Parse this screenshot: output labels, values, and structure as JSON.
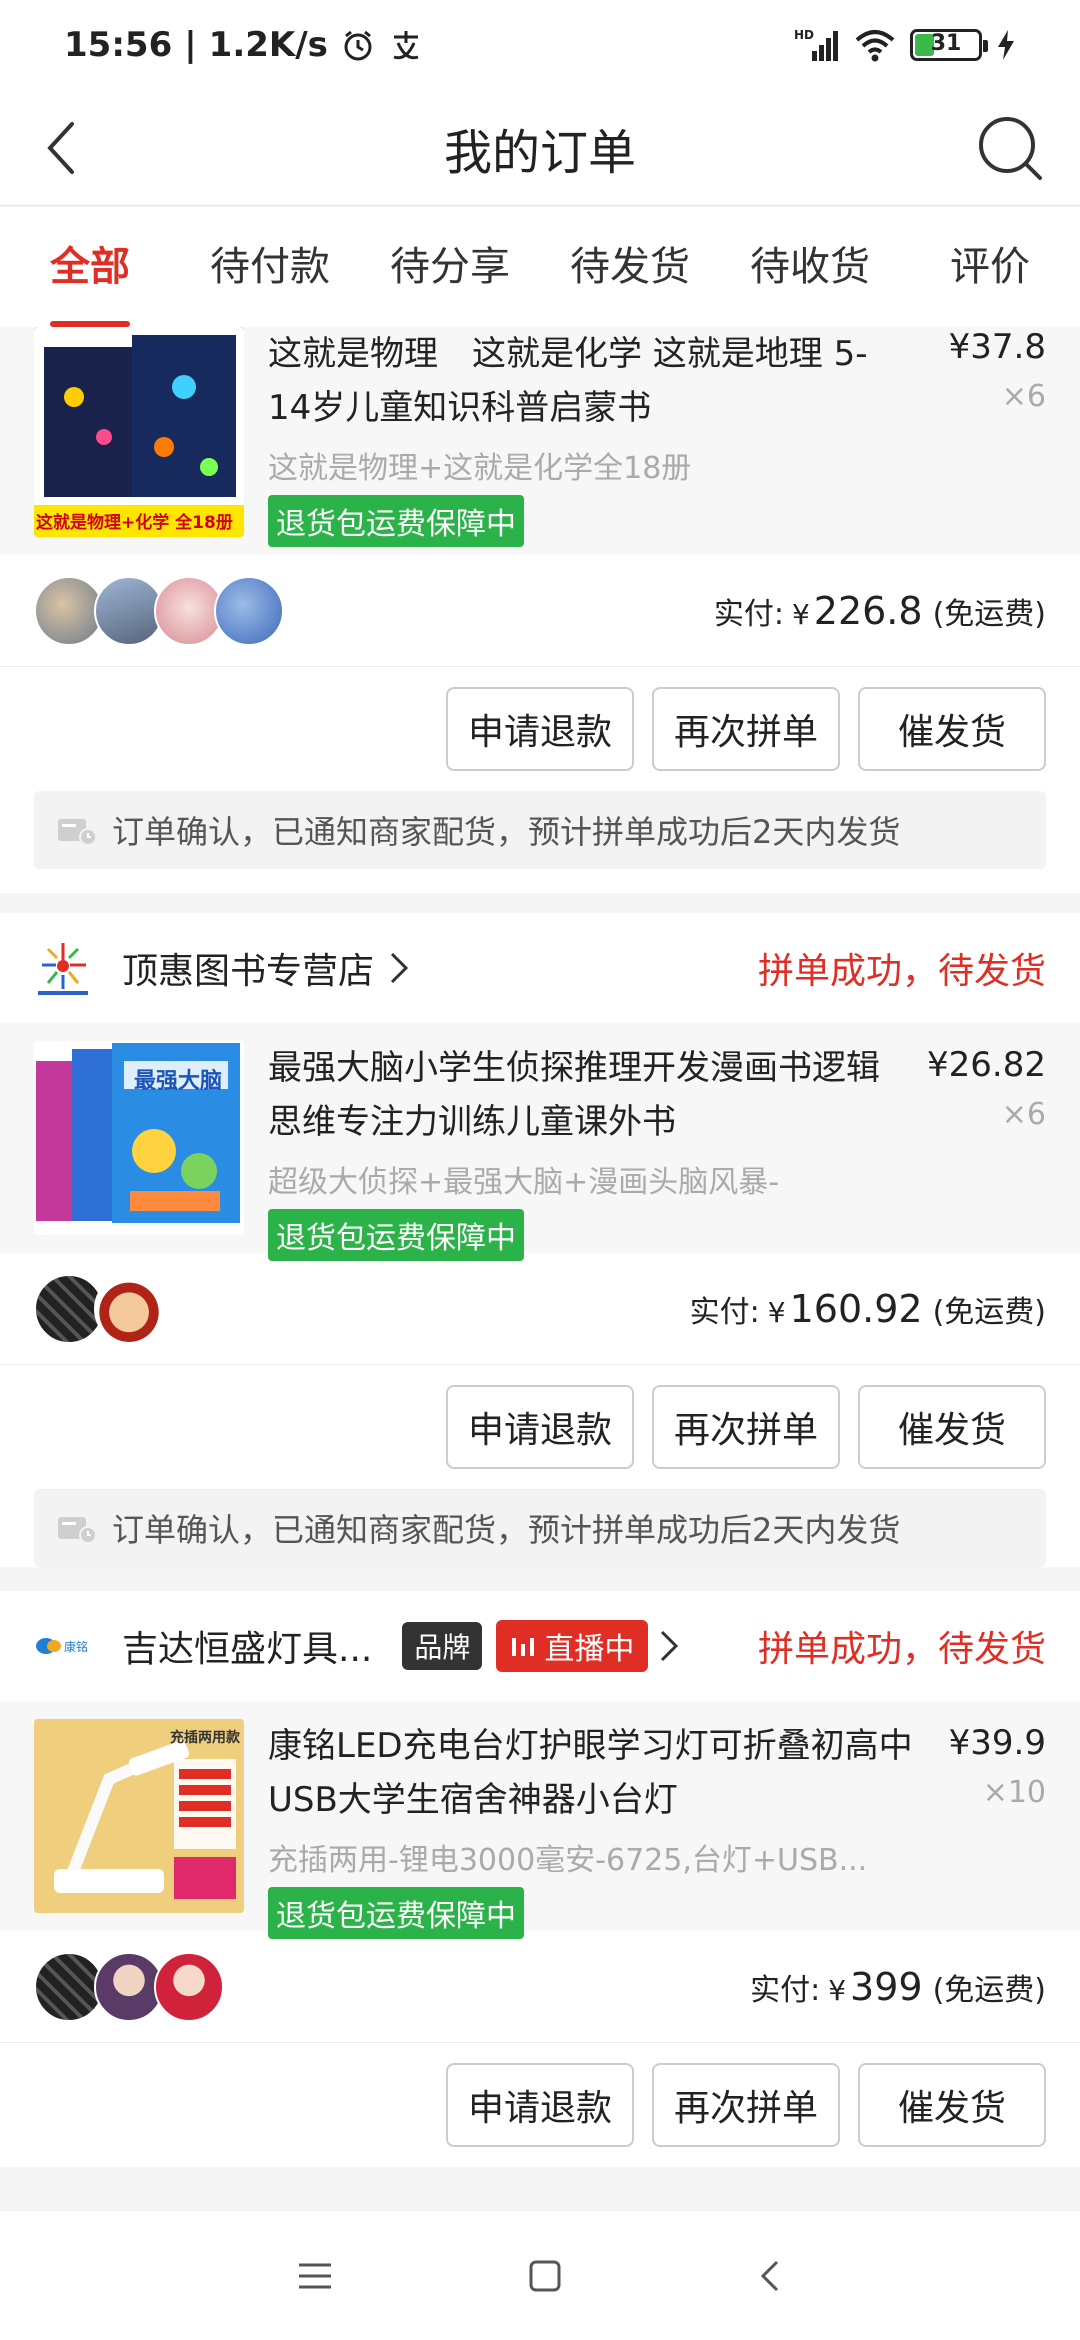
{
  "status_bar": {
    "time": "15:56",
    "speed": "1.2K/s",
    "battery": "31",
    "network": "HD"
  },
  "nav": {
    "title": "我的订单"
  },
  "tabs": [
    "全部",
    "待付款",
    "待分享",
    "待发货",
    "待收货",
    "评价"
  ],
  "active_tab": "全部",
  "orders": [
    {
      "product": {
        "title": "这就是物理　这就是化学  这就是地理 5-14岁儿童知识科普启蒙书",
        "spec": "这就是物理+这就是化学全18册",
        "guarantee": "退货包运费保障中",
        "price": "¥37.8",
        "qty": "×6",
        "thumb_caption": "这就是物理+化学 全18册"
      },
      "paid_label": "实付:",
      "paid_currency": "¥",
      "paid_amount": "226.8",
      "shipping": "(免运费)",
      "buttons": [
        "申请退款",
        "再次拼单",
        "催发货"
      ],
      "notice": "订单确认，已通知商家配货，预计拼单成功后2天内发货"
    },
    {
      "shop": {
        "name": "顶惠图书专营店",
        "status": "拼单成功，待发货"
      },
      "product": {
        "title": "最强大脑小学生侦探推理开发漫画书逻辑思维专注力训练儿童课外书",
        "spec": "超级大侦探+最强大脑+漫画头脑风暴-",
        "guarantee": "退货包运费保障中",
        "price": "¥26.82",
        "qty": "×6",
        "thumb_caption": "最强大脑"
      },
      "paid_label": "实付:",
      "paid_currency": "¥",
      "paid_amount": "160.92",
      "shipping": "(免运费)",
      "buttons": [
        "申请退款",
        "再次拼单",
        "催发货"
      ],
      "notice": "订单确认，已通知商家配货，预计拼单成功后2天内发货"
    },
    {
      "shop": {
        "name": "吉达恒盛灯具...",
        "status": "拼单成功，待发货",
        "brand_tag": "品牌",
        "live_tag": "直播中",
        "logo_text": "康铭"
      },
      "product": {
        "title": "康铭LED充电台灯护眼学习灯可折叠初高中USB大学生宿舍神器小台灯",
        "spec": "充插两用-锂电3000毫安-6725,台灯+USB...",
        "guarantee": "退货包运费保障中",
        "price": "¥39.9",
        "qty": "×10",
        "thumb_caption": "充插两用款"
      },
      "paid_label": "实付:",
      "paid_currency": "¥",
      "paid_amount": "399",
      "shipping": "(免运费)",
      "buttons": [
        "申请退款",
        "再次拼单",
        "催发货"
      ]
    }
  ],
  "colors": {
    "accent": "#e02e24",
    "guarantee": "#2bb34a",
    "background": "#f5f5f5"
  }
}
